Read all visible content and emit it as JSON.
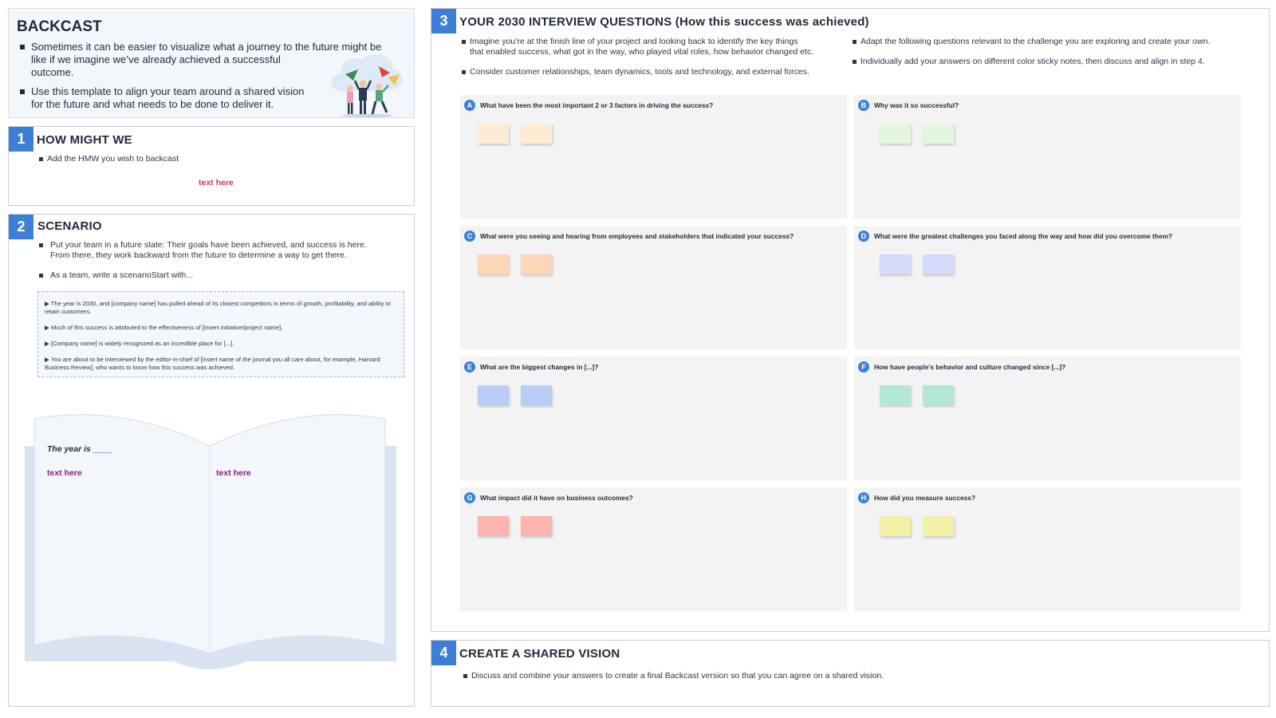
{
  "intro": {
    "title": "BACKCAST",
    "bullet1_line1": "Sometimes it can be easier to visualize what a journey to the future might be",
    "bullet1_line2": "like if we imagine we’ve already achieved a successful",
    "bullet1_line3": "outcome.",
    "bullet2_line1": "Use this template to align your team around a shared vision",
    "bullet2_line2": "for the future and what needs to be done to deliver it."
  },
  "sec1": {
    "number": "1",
    "title": "HOW MIGHT WE",
    "bullet": "Add the HMW you wish to backcast",
    "placeholder": "text here"
  },
  "sec2": {
    "number": "2",
    "title": "SCENARIO",
    "bullet1_line1": "Put your team in a future state: Their goals have been achieved, and success is here.",
    "bullet1_line2": "From there, they work backward from the future to determine a way to get there.",
    "bullet2": "As a team, write a scenarioStart with...",
    "scenario": [
      "▶ The year is 2030, and [company name] has pulled ahead of its closest competitors in terms of growth, profitability, and ability to retain customers.",
      "▶ Much of this success is attributed to the effectiveness of [insert initiative/project name].",
      "▶ [Company name] is widely recognized as an incredible place for [...].",
      "▶ You are about to be interviewed by the editor-in-chief of [insert name of the journal you all care about, for example, Harvard Business Review], who wants to know how this success was achieved."
    ],
    "book_year": "The year is ____",
    "book_left": "text here",
    "book_right": "text here"
  },
  "sec3": {
    "number": "3",
    "title": "YOUR 2030 INTERVIEW QUESTIONS (How this success was achieved)",
    "bullet1_line1": "Imagine you’re at the finish line of your project and looking back to identify the key things",
    "bullet1_line2": "that enabled success, what got in the way, who played vital roles, how behavior changed etc.",
    "bullet2": "Consider customer relationships, team dynamics, tools and technology, and external forces.",
    "bullet3": "Adapt the following questions relevant to the challenge you are exploring and create your own.",
    "bullet4": "Individually add your answers on different color sticky notes, then discuss and align in step 4.",
    "questions": [
      {
        "letter": "A",
        "text": "What have been the most important 2 or 3 factors in driving the success?",
        "color": "#fdebd6"
      },
      {
        "letter": "B",
        "text": "Why was it so successful?",
        "color": "#e4f6e0"
      },
      {
        "letter": "C",
        "text": "What were you seeing and hearing from employees and stakeholders that indicated your success?",
        "color": "#fdd6b8"
      },
      {
        "letter": "D",
        "text": "What were the greatest challenges you faced along the way and how did you overcome them?",
        "color": "#d4dbfa"
      },
      {
        "letter": "E",
        "text": "What are the biggest changes in [...]?",
        "color": "#b9cdf6"
      },
      {
        "letter": "F",
        "text": "How have people’s behavior and culture changed since [...]?",
        "color": "#b4e8d4"
      },
      {
        "letter": "G",
        "text": "What impact did it have on business outcomes?",
        "color": "#fbb5ae"
      },
      {
        "letter": "H",
        "text": "How did you measure success?",
        "color": "#f3f0a8"
      }
    ]
  },
  "sec4": {
    "number": "4",
    "title": "CREATE A SHARED VISION",
    "bullet": "Discuss and combine your answers to create a final Backcast version so that you can agree on a shared vision."
  },
  "colors": {
    "accent": "#3d7fd6",
    "placeholder_red": "#e0314b",
    "placeholder_purple": "#8b1a8b"
  }
}
